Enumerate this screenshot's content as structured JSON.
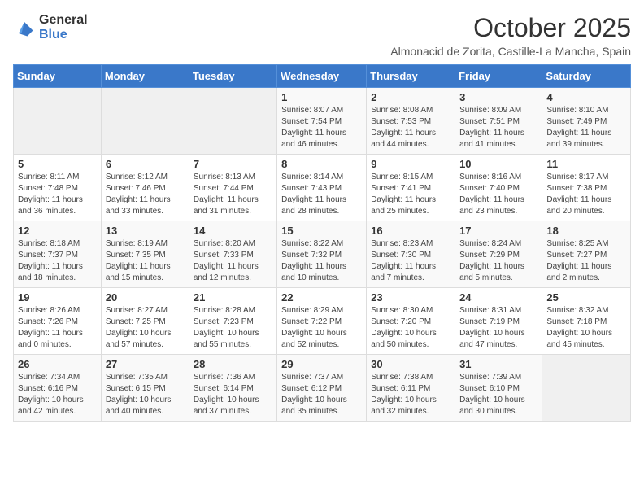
{
  "logo": {
    "general": "General",
    "blue": "Blue"
  },
  "title": "October 2025",
  "location": "Almonacid de Zorita, Castille-La Mancha, Spain",
  "days_of_week": [
    "Sunday",
    "Monday",
    "Tuesday",
    "Wednesday",
    "Thursday",
    "Friday",
    "Saturday"
  ],
  "weeks": [
    [
      {
        "day": "",
        "info": ""
      },
      {
        "day": "",
        "info": ""
      },
      {
        "day": "",
        "info": ""
      },
      {
        "day": "1",
        "info": "Sunrise: 8:07 AM\nSunset: 7:54 PM\nDaylight: 11 hours and 46 minutes."
      },
      {
        "day": "2",
        "info": "Sunrise: 8:08 AM\nSunset: 7:53 PM\nDaylight: 11 hours and 44 minutes."
      },
      {
        "day": "3",
        "info": "Sunrise: 8:09 AM\nSunset: 7:51 PM\nDaylight: 11 hours and 41 minutes."
      },
      {
        "day": "4",
        "info": "Sunrise: 8:10 AM\nSunset: 7:49 PM\nDaylight: 11 hours and 39 minutes."
      }
    ],
    [
      {
        "day": "5",
        "info": "Sunrise: 8:11 AM\nSunset: 7:48 PM\nDaylight: 11 hours and 36 minutes."
      },
      {
        "day": "6",
        "info": "Sunrise: 8:12 AM\nSunset: 7:46 PM\nDaylight: 11 hours and 33 minutes."
      },
      {
        "day": "7",
        "info": "Sunrise: 8:13 AM\nSunset: 7:44 PM\nDaylight: 11 hours and 31 minutes."
      },
      {
        "day": "8",
        "info": "Sunrise: 8:14 AM\nSunset: 7:43 PM\nDaylight: 11 hours and 28 minutes."
      },
      {
        "day": "9",
        "info": "Sunrise: 8:15 AM\nSunset: 7:41 PM\nDaylight: 11 hours and 25 minutes."
      },
      {
        "day": "10",
        "info": "Sunrise: 8:16 AM\nSunset: 7:40 PM\nDaylight: 11 hours and 23 minutes."
      },
      {
        "day": "11",
        "info": "Sunrise: 8:17 AM\nSunset: 7:38 PM\nDaylight: 11 hours and 20 minutes."
      }
    ],
    [
      {
        "day": "12",
        "info": "Sunrise: 8:18 AM\nSunset: 7:37 PM\nDaylight: 11 hours and 18 minutes."
      },
      {
        "day": "13",
        "info": "Sunrise: 8:19 AM\nSunset: 7:35 PM\nDaylight: 11 hours and 15 minutes."
      },
      {
        "day": "14",
        "info": "Sunrise: 8:20 AM\nSunset: 7:33 PM\nDaylight: 11 hours and 12 minutes."
      },
      {
        "day": "15",
        "info": "Sunrise: 8:22 AM\nSunset: 7:32 PM\nDaylight: 11 hours and 10 minutes."
      },
      {
        "day": "16",
        "info": "Sunrise: 8:23 AM\nSunset: 7:30 PM\nDaylight: 11 hours and 7 minutes."
      },
      {
        "day": "17",
        "info": "Sunrise: 8:24 AM\nSunset: 7:29 PM\nDaylight: 11 hours and 5 minutes."
      },
      {
        "day": "18",
        "info": "Sunrise: 8:25 AM\nSunset: 7:27 PM\nDaylight: 11 hours and 2 minutes."
      }
    ],
    [
      {
        "day": "19",
        "info": "Sunrise: 8:26 AM\nSunset: 7:26 PM\nDaylight: 11 hours and 0 minutes."
      },
      {
        "day": "20",
        "info": "Sunrise: 8:27 AM\nSunset: 7:25 PM\nDaylight: 10 hours and 57 minutes."
      },
      {
        "day": "21",
        "info": "Sunrise: 8:28 AM\nSunset: 7:23 PM\nDaylight: 10 hours and 55 minutes."
      },
      {
        "day": "22",
        "info": "Sunrise: 8:29 AM\nSunset: 7:22 PM\nDaylight: 10 hours and 52 minutes."
      },
      {
        "day": "23",
        "info": "Sunrise: 8:30 AM\nSunset: 7:20 PM\nDaylight: 10 hours and 50 minutes."
      },
      {
        "day": "24",
        "info": "Sunrise: 8:31 AM\nSunset: 7:19 PM\nDaylight: 10 hours and 47 minutes."
      },
      {
        "day": "25",
        "info": "Sunrise: 8:32 AM\nSunset: 7:18 PM\nDaylight: 10 hours and 45 minutes."
      }
    ],
    [
      {
        "day": "26",
        "info": "Sunrise: 7:34 AM\nSunset: 6:16 PM\nDaylight: 10 hours and 42 minutes."
      },
      {
        "day": "27",
        "info": "Sunrise: 7:35 AM\nSunset: 6:15 PM\nDaylight: 10 hours and 40 minutes."
      },
      {
        "day": "28",
        "info": "Sunrise: 7:36 AM\nSunset: 6:14 PM\nDaylight: 10 hours and 37 minutes."
      },
      {
        "day": "29",
        "info": "Sunrise: 7:37 AM\nSunset: 6:12 PM\nDaylight: 10 hours and 35 minutes."
      },
      {
        "day": "30",
        "info": "Sunrise: 7:38 AM\nSunset: 6:11 PM\nDaylight: 10 hours and 32 minutes."
      },
      {
        "day": "31",
        "info": "Sunrise: 7:39 AM\nSunset: 6:10 PM\nDaylight: 10 hours and 30 minutes."
      },
      {
        "day": "",
        "info": ""
      }
    ]
  ]
}
